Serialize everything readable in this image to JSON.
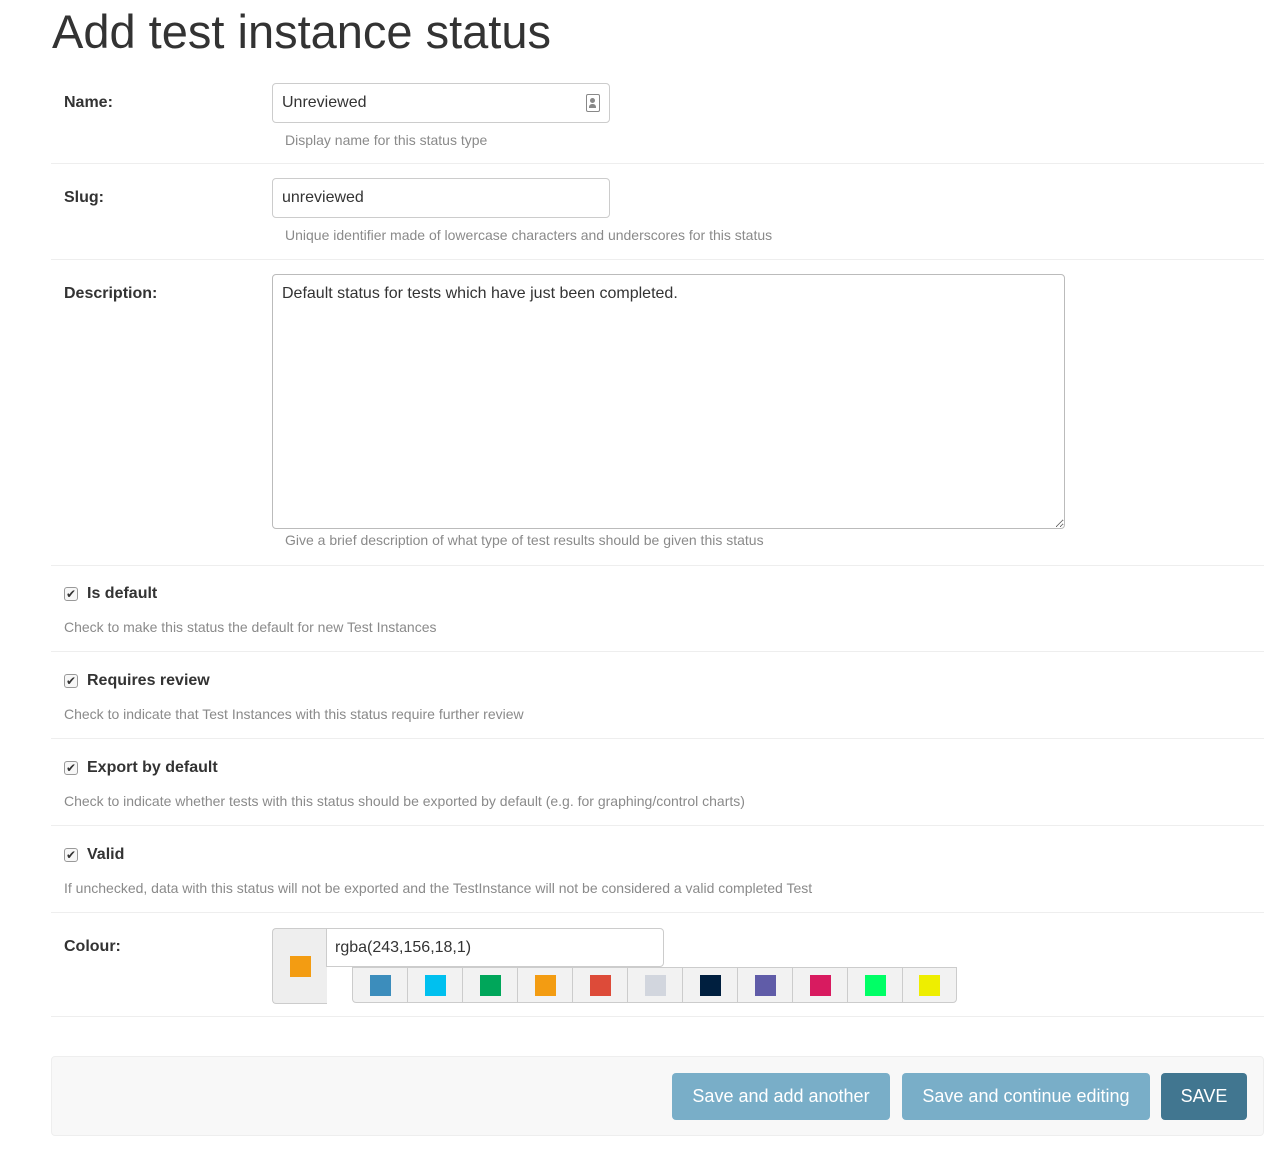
{
  "page": {
    "title": "Add test instance status"
  },
  "fields": {
    "name": {
      "label": "Name:",
      "value": "Unreviewed",
      "help": "Display name for this status type",
      "icon": "contact-card-icon"
    },
    "slug": {
      "label": "Slug:",
      "value": "unreviewed",
      "help": "Unique identifier made of lowercase characters and underscores for this status"
    },
    "description": {
      "label": "Description:",
      "value": "Default status for tests which have just been completed.",
      "help": "Give a brief description of what type of test results should be given this status"
    }
  },
  "checkboxes": {
    "is_default": {
      "label": "Is default",
      "checked": true,
      "help": "Check to make this status the default for new Test Instances"
    },
    "requires_review": {
      "label": "Requires review",
      "checked": true,
      "help": "Check to indicate that Test Instances with this status require further review"
    },
    "export_by_default": {
      "label": "Export by default",
      "checked": true,
      "help": "Check to indicate whether tests with this status should be exported by default (e.g. for graphing/control charts)"
    },
    "valid": {
      "label": "Valid",
      "checked": true,
      "help": "If unchecked, data with this status will not be exported and the TestInstance will not be considered a valid completed Test"
    }
  },
  "colour": {
    "label": "Colour:",
    "value": "rgba(243,156,18,1)",
    "swatch": "#f39c12",
    "palette": [
      "#3c8dbc",
      "#00c0ef",
      "#00a65a",
      "#f39c12",
      "#dd4b39",
      "#d2d6de",
      "#001f3f",
      "#605ca8",
      "#d81b60",
      "#00ff66",
      "#eeee00"
    ]
  },
  "buttons": {
    "save_add_another": "Save and add another",
    "save_continue": "Save and continue editing",
    "save": "SAVE"
  },
  "colors": {
    "secondary_button": "#79aec8",
    "primary_button": "#417690"
  }
}
